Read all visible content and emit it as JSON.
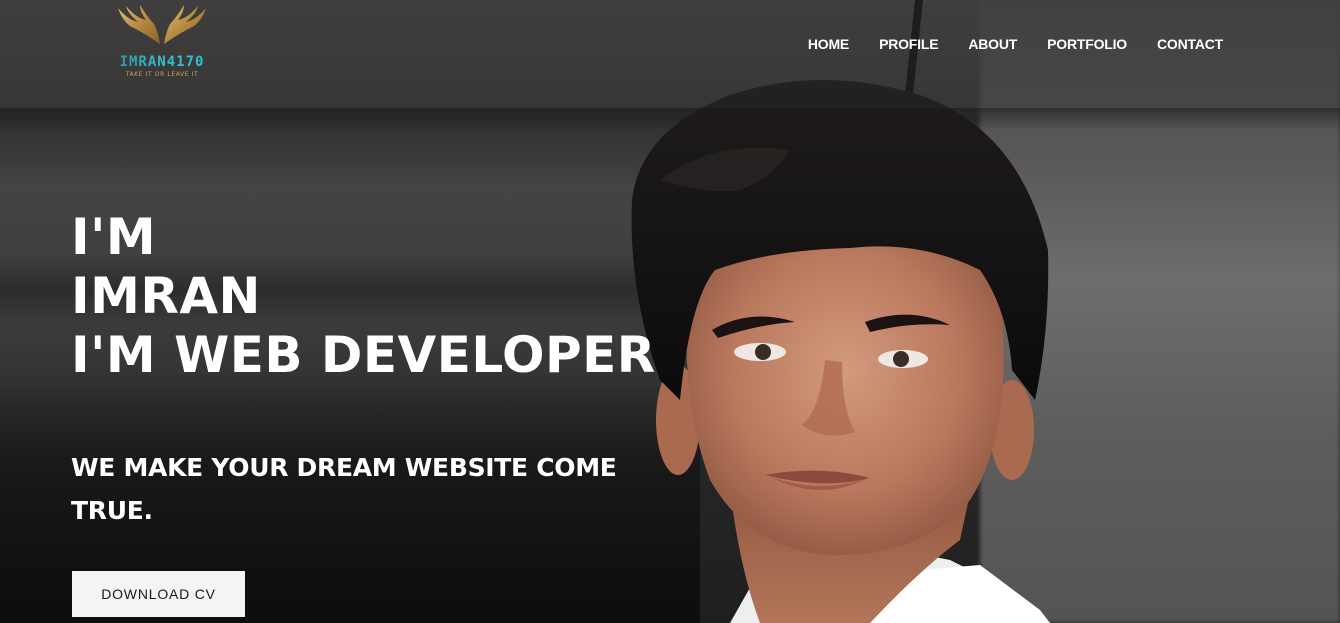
{
  "brand": {
    "name": "IMRAN4170",
    "tagline": "TAKE IT OR LEAVE IT",
    "logo_icon": "golden-wings-icon",
    "gold": "#c9a25c",
    "teal": "#2ab5c6"
  },
  "nav": {
    "items": [
      {
        "label": "HOME"
      },
      {
        "label": "PROFILE"
      },
      {
        "label": "ABOUT"
      },
      {
        "label": "PORTFOLIO"
      },
      {
        "label": "CONTACT"
      }
    ]
  },
  "hero": {
    "line1": "I'M",
    "line2": "IMRAN",
    "line3": "I'M WEB DEVELOPER",
    "subtitle": "WE MAKE YOUR DREAM WEBSITE COME TRUE.",
    "cta_label": "DOWNLOAD CV"
  },
  "colors": {
    "text": "#ffffff",
    "button_bg": "#f4f4f4",
    "button_text": "#1a1a1a"
  }
}
